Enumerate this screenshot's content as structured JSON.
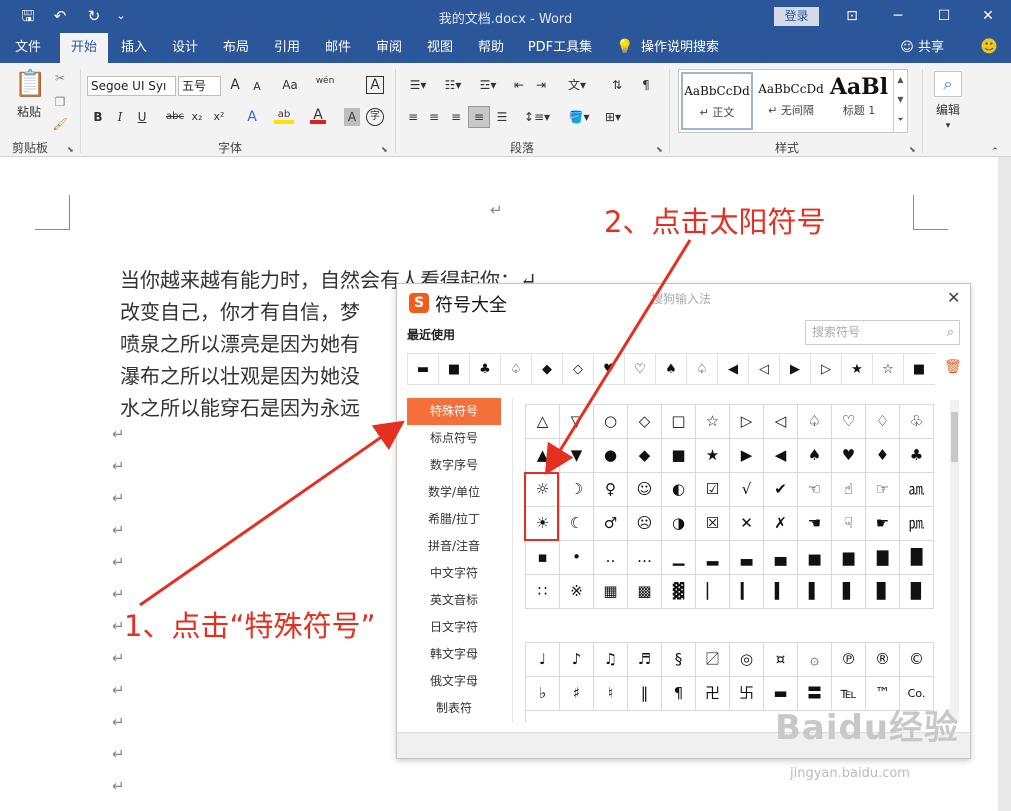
{
  "titlebar": {
    "title": "我的文档.docx - Word",
    "login_label": "登录",
    "save_icon": "save-icon",
    "undo_icon": "undo-icon",
    "redo_icon": "redo-icon",
    "qa_glyphs": [
      "🖫",
      "↶",
      "↻",
      "⌄"
    ],
    "win_glyphs": [
      "⊡",
      "─",
      "☐",
      "✕"
    ],
    "accent": "#2b579a"
  },
  "tabs": [
    "文件",
    "开始",
    "插入",
    "设计",
    "布局",
    "引用",
    "邮件",
    "审阅",
    "视图",
    "帮助",
    "PDF工具集",
    "操作说明搜索"
  ],
  "share_label": "共享",
  "ribbon": {
    "clipboard": {
      "paste": "粘贴",
      "label": "剪贴板"
    },
    "font": {
      "name": "Segoe UI Syı",
      "size": "五号",
      "glyphs": [
        "A",
        "A",
        "Aa",
        "wén",
        "A",
        "B",
        "I",
        "U",
        "abc",
        "x₂",
        "x²",
        "A",
        "ab",
        "A",
        "A",
        "字"
      ],
      "label": "字体"
    },
    "paragraph": {
      "label": "段落"
    },
    "styles": {
      "items": [
        {
          "preview": "AaBbCcDd",
          "name": "↵ 正文"
        },
        {
          "preview": "AaBbCcDd",
          "name": "↵ 无间隔"
        },
        {
          "preview": "AaBl",
          "name": "标题 1"
        }
      ],
      "label": "样式"
    },
    "edit": {
      "label": "编辑"
    }
  },
  "document": {
    "mark": "↵",
    "lines": [
      "当你越来越有能力时，自然会有人看得起你；↵",
      "改变自己，你才有自信，梦",
      "喷泉之所以漂亮是因为她有",
      "瀑布之所以壮观是因为她没",
      "水之所以能穿石是因为永远"
    ]
  },
  "symbol_panel": {
    "title": "符号大全",
    "logo": "S",
    "subtitle": "搜狗输入法",
    "close": "✕",
    "recent_label": "最近使用",
    "search_placeholder": "搜索符号",
    "trash_icon": "trash-icon",
    "recent": [
      "▬",
      "■",
      "♣",
      "♤",
      "◆",
      "◇",
      "♥",
      "♡",
      "♠",
      "♤",
      "◀",
      "◁",
      "▶",
      "▷",
      "★",
      "☆",
      "■"
    ],
    "categories": [
      "特殊符号",
      "标点符号",
      "数字序号",
      "数学/单位",
      "希腊/拉丁",
      "拼音/注音",
      "中文字符",
      "英文音标",
      "日文字符",
      "韩文字母",
      "俄文字母",
      "制表符"
    ],
    "selected_category": "特殊符号",
    "grid1": [
      [
        "△",
        "▽",
        "○",
        "◇",
        "□",
        "☆",
        "▷",
        "◁",
        "♤",
        "♡",
        "♢",
        "♧"
      ],
      [
        "▲",
        "▼",
        "●",
        "◆",
        "■",
        "★",
        "▶",
        "◀",
        "♠",
        "♥",
        "♦",
        "♣"
      ],
      [
        "☼",
        "☽",
        "♀",
        "☺",
        "◐",
        "☑",
        "√",
        "✔",
        "☜",
        "☝",
        "☞",
        "㏂"
      ],
      [
        "☀",
        "☾",
        "♂",
        "☹",
        "◑",
        "☒",
        "✕",
        "✗",
        "☚",
        "☟",
        "☛",
        "㏘"
      ],
      [
        "▪",
        "•",
        "‥",
        "…",
        "▁",
        "▂",
        "▃",
        "▄",
        "▅",
        "▆",
        "▇",
        "█"
      ],
      [
        "∷",
        "※",
        "▦",
        "▩",
        "▓",
        "▏",
        "▎",
        "▍",
        "▌",
        "▋",
        "▊",
        "▉"
      ]
    ],
    "grid2": [
      [
        "♩",
        "♪",
        "♫",
        "♬",
        "§",
        "〼",
        "◎",
        "¤",
        "۞",
        "℗",
        "®",
        "©"
      ],
      [
        "♭",
        "♯",
        "♮",
        "‖",
        "¶",
        "卍",
        "卐",
        "▬",
        "〓",
        "℡",
        "™",
        "Co."
      ]
    ]
  },
  "annotations": {
    "step1": "1、点击“特殊符号”",
    "step2": "2、点击太阳符号",
    "color": "#e53020"
  },
  "watermark": {
    "text": "Baidu经验",
    "url": "jingyan.baidu.com"
  }
}
